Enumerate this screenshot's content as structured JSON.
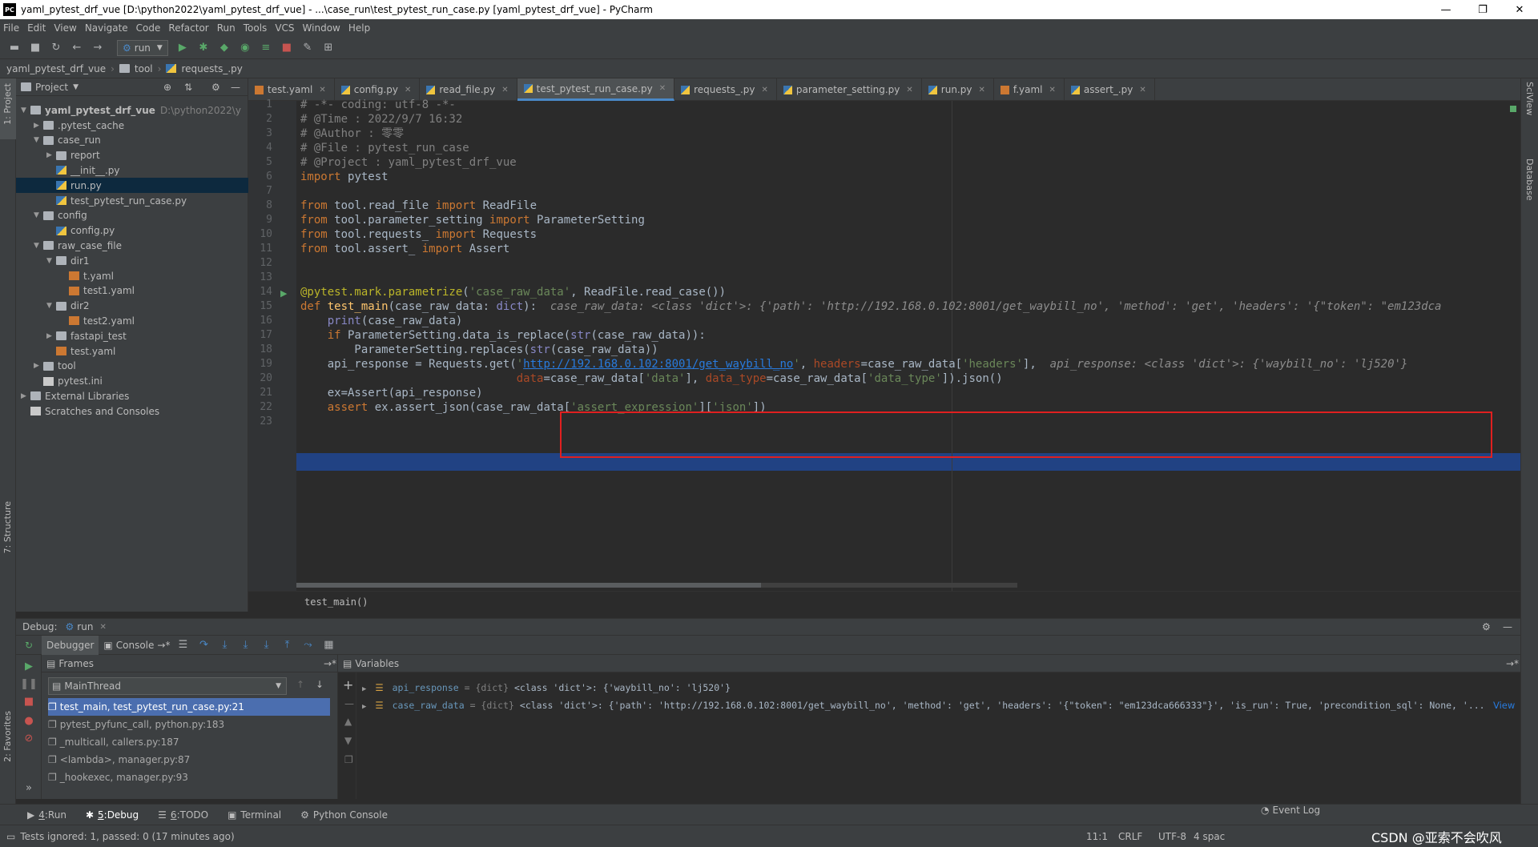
{
  "window": {
    "title": "yaml_pytest_drf_vue [D:\\python2022\\yaml_pytest_drf_vue] - ...\\case_run\\test_pytest_run_case.py [yaml_pytest_drf_vue] - PyCharm",
    "min": "—",
    "max": "❐",
    "close": "✕",
    "app_icon": "PC"
  },
  "menu": [
    "File",
    "Edit",
    "View",
    "Navigate",
    "Code",
    "Refactor",
    "Run",
    "Tools",
    "VCS",
    "Window",
    "Help"
  ],
  "toolbar": {
    "run_config": "run"
  },
  "navbar": {
    "items": [
      "yaml_pytest_drf_vue",
      "tool",
      "requests_.py"
    ]
  },
  "side_strip": {
    "project": "1: Project",
    "structure": "7: Structure",
    "favorites": "2: Favorites",
    "sciview": "SciView",
    "database": "Database"
  },
  "project": {
    "title": "Project",
    "root": "yaml_pytest_drf_vue",
    "root_path": "D:\\python2022\\y",
    "tree": [
      {
        "label": ".pytest_cache",
        "type": "folder",
        "level": 1,
        "arrow": "▶"
      },
      {
        "label": "case_run",
        "type": "folder",
        "level": 1,
        "arrow": "▼"
      },
      {
        "label": "report",
        "type": "folder",
        "level": 2,
        "arrow": "▶"
      },
      {
        "label": "__init__.py",
        "type": "py",
        "level": 2,
        "arrow": ""
      },
      {
        "label": "run.py",
        "type": "py",
        "level": 2,
        "arrow": "",
        "selected": true
      },
      {
        "label": "test_pytest_run_case.py",
        "type": "py",
        "level": 2,
        "arrow": ""
      },
      {
        "label": "config",
        "type": "folder",
        "level": 1,
        "arrow": "▼"
      },
      {
        "label": "config.py",
        "type": "py",
        "level": 2,
        "arrow": ""
      },
      {
        "label": "raw_case_file",
        "type": "folder",
        "level": 1,
        "arrow": "▼"
      },
      {
        "label": "dir1",
        "type": "folder",
        "level": 2,
        "arrow": "▼"
      },
      {
        "label": "t.yaml",
        "type": "yml",
        "level": 3,
        "arrow": ""
      },
      {
        "label": "test1.yaml",
        "type": "yml",
        "level": 3,
        "arrow": ""
      },
      {
        "label": "dir2",
        "type": "folder",
        "level": 2,
        "arrow": "▼"
      },
      {
        "label": "test2.yaml",
        "type": "yml",
        "level": 3,
        "arrow": ""
      },
      {
        "label": "fastapi_test",
        "type": "folder",
        "level": 2,
        "arrow": "▶"
      },
      {
        "label": "test.yaml",
        "type": "yml",
        "level": 2,
        "arrow": ""
      },
      {
        "label": "tool",
        "type": "folder",
        "level": 1,
        "arrow": "▶"
      },
      {
        "label": "pytest.ini",
        "type": "txt",
        "level": 1,
        "arrow": ""
      },
      {
        "label": "External Libraries",
        "type": "lib",
        "level": 0,
        "arrow": "▶"
      },
      {
        "label": "Scratches and Consoles",
        "type": "scratch",
        "level": 0,
        "arrow": ""
      }
    ]
  },
  "tabs": [
    {
      "label": "test.yaml",
      "type": "yml"
    },
    {
      "label": "config.py",
      "type": "py"
    },
    {
      "label": "read_file.py",
      "type": "py"
    },
    {
      "label": "test_pytest_run_case.py",
      "type": "py",
      "active": true
    },
    {
      "label": "requests_.py",
      "type": "py"
    },
    {
      "label": "parameter_setting.py",
      "type": "py"
    },
    {
      "label": "run.py",
      "type": "py"
    },
    {
      "label": "f.yaml",
      "type": "yml"
    },
    {
      "label": "assert_.py",
      "type": "py"
    }
  ],
  "code": [
    [
      [
        "c",
        "# -*- coding: utf-8 -*-"
      ]
    ],
    [
      [
        "c",
        "# @Time : 2022/9/7 16:32"
      ]
    ],
    [
      [
        "c",
        "# @Author : 零零"
      ]
    ],
    [
      [
        "c",
        "# @File : pytest_run_case"
      ]
    ],
    [
      [
        "c",
        "# @Project : yaml_pytest_drf_vue"
      ]
    ],
    [
      [
        "k",
        "import "
      ],
      [
        "n",
        "pytest"
      ]
    ],
    [],
    [
      [
        "k",
        "from "
      ],
      [
        "n",
        "tool.read_file "
      ],
      [
        "k",
        "import "
      ],
      [
        "n",
        "ReadFile"
      ]
    ],
    [
      [
        "k",
        "from "
      ],
      [
        "n",
        "tool.parameter_setting "
      ],
      [
        "k",
        "import "
      ],
      [
        "n",
        "ParameterSetting"
      ]
    ],
    [
      [
        "k",
        "from "
      ],
      [
        "n",
        "tool.requests_ "
      ],
      [
        "k",
        "import "
      ],
      [
        "n",
        "Requests"
      ]
    ],
    [
      [
        "k",
        "from "
      ],
      [
        "n",
        "tool.assert_ "
      ],
      [
        "k",
        "import "
      ],
      [
        "n",
        "Assert"
      ]
    ],
    [],
    [],
    [
      [
        "d",
        "@pytest.mark.parametrize"
      ],
      [
        "n",
        "("
      ],
      [
        "s",
        "'case_raw_data'"
      ],
      [
        "n",
        ", ReadFile.read_case())"
      ]
    ],
    [
      [
        "k",
        "def "
      ],
      [
        "f",
        "test_main"
      ],
      [
        "n",
        "(case_raw_data: "
      ],
      [
        "b",
        "dict"
      ],
      [
        "n",
        "):  "
      ],
      [
        "h",
        "case_raw_data: <class 'dict'>: {'path': 'http://192.168.0.102:8001/get_waybill_no', 'method': 'get', 'headers': '{\"token\": \"em123dca"
      ]
    ],
    [
      [
        "n",
        "    "
      ],
      [
        "b",
        "print"
      ],
      [
        "n",
        "(case_raw_data)"
      ]
    ],
    [
      [
        "n",
        "    "
      ],
      [
        "k",
        "if "
      ],
      [
        "n",
        "ParameterSetting.data_is_replace("
      ],
      [
        "b",
        "str"
      ],
      [
        "n",
        "(case_raw_data)):"
      ]
    ],
    [
      [
        "n",
        "        ParameterSetting.replaces("
      ],
      [
        "b",
        "str"
      ],
      [
        "n",
        "(case_raw_data))"
      ]
    ],
    [
      [
        "n",
        "    api_response = Requests.get("
      ],
      [
        "s",
        "'"
      ],
      [
        "u",
        "http://192.168.0.102:8001/get_waybill_no"
      ],
      [
        "s",
        "'"
      ],
      [
        "n",
        ", "
      ],
      [
        "p",
        "headers"
      ],
      [
        "n",
        "=case_raw_data["
      ],
      [
        "s",
        "'headers'"
      ],
      [
        "n",
        "],  "
      ],
      [
        "h",
        "api_response: <class 'dict'>: {'waybill_no': 'lj520'}"
      ]
    ],
    [
      [
        "n",
        "                                "
      ],
      [
        "p",
        "data"
      ],
      [
        "n",
        "=case_raw_data["
      ],
      [
        "s",
        "'data'"
      ],
      [
        "n",
        "], "
      ],
      [
        "p",
        "data_type"
      ],
      [
        "n",
        "=case_raw_data["
      ],
      [
        "s",
        "'data_type'"
      ],
      [
        "n",
        "]).json()"
      ]
    ],
    [
      [
        "n",
        "    ex=Assert(api_response)"
      ]
    ],
    [
      [
        "n",
        "    "
      ],
      [
        "k",
        "assert "
      ],
      [
        "n",
        "ex.assert_json(case_raw_data["
      ],
      [
        "s",
        "'assert_expression'"
      ],
      [
        "n",
        "]["
      ],
      [
        "s",
        "'json'"
      ],
      [
        "n",
        "])"
      ]
    ],
    []
  ],
  "breadcrumb_func": "test_main()",
  "debug": {
    "label": "Debug:",
    "run_tab": "run",
    "debugger": "Debugger",
    "console": "Console",
    "frames": "Frames",
    "thread": "MainThread",
    "variables": "Variables"
  },
  "frames": [
    "test_main, test_pytest_run_case.py:21",
    "pytest_pyfunc_call, python.py:183",
    "_multicall, callers.py:187",
    "<lambda>, manager.py:87",
    "_hookexec, manager.py:93"
  ],
  "variables": [
    {
      "name": "api_response",
      "type": "= {dict}",
      "value": "<class 'dict'>: {'waybill_no': 'lj520'}"
    },
    {
      "name": "case_raw_data",
      "type": "= {dict}",
      "value": "<class 'dict'>: {'path': 'http://192.168.0.102:8001/get_waybill_no', 'method': 'get', 'headers': '{\"token\": \"em123dca666333\"}', 'is_run': True, 'precondition_sql': None, '...",
      "view": "View"
    }
  ],
  "bottom_tabs": [
    {
      "key": "4",
      "label": "Run"
    },
    {
      "key": "5",
      "label": "Debug",
      "active": true
    },
    {
      "key": "6",
      "label": "TODO"
    },
    {
      "key": "",
      "label": "Terminal"
    },
    {
      "key": "",
      "label": "Python Console"
    }
  ],
  "event_log": "Event Log",
  "status": {
    "message": "Tests ignored: 1, passed: 0 (17 minutes ago)",
    "position": "11:1",
    "line_sep": "CRLF",
    "encoding": "UTF-8",
    "indent": "4 spac",
    "watermark": "CSDN @亚索不会吹风"
  }
}
